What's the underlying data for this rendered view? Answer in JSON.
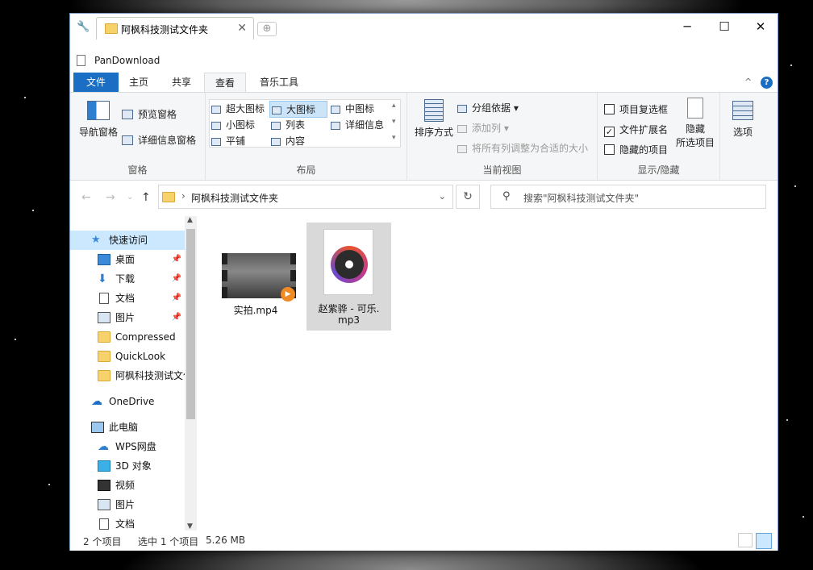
{
  "window": {
    "tab_title": "阿枫科技测试文件夹",
    "address_title": "PanDownload"
  },
  "ribbon_tabs": [
    "文件",
    "主页",
    "共享",
    "查看",
    "音乐工具"
  ],
  "ribbon": {
    "panes": {
      "nav_pane": "导航窗格",
      "preview_pane": "预览窗格",
      "details_pane": "详细信息窗格",
      "group": "窗格"
    },
    "layout": {
      "items": [
        "超大图标",
        "大图标",
        "中图标",
        "小图标",
        "列表",
        "详细信息",
        "平铺",
        "内容"
      ],
      "selected": "大图标",
      "group": "布局"
    },
    "current_view": {
      "sort": "排序方式",
      "group_by": "分组依据",
      "add_columns": "添加列",
      "fit_columns": "将所有列调整为合适的大小",
      "group": "当前视图"
    },
    "show_hide": {
      "item_checkboxes": "项目复选框",
      "file_extensions": "文件扩展名",
      "hidden_items": "隐藏的项目",
      "hide_selected_1": "隐藏",
      "hide_selected_2": "所选项目",
      "group": "显示/隐藏"
    },
    "options": "选项"
  },
  "address": {
    "crumb": "阿枫科技测试文件夹",
    "search_placeholder": "搜索\"阿枫科技测试文件夹\""
  },
  "nav_pane": {
    "items": [
      {
        "label": "快速访问",
        "icon": "star-icon"
      },
      {
        "label": "桌面",
        "icon": "desktop-icon"
      },
      {
        "label": "下载",
        "icon": "download-icon"
      },
      {
        "label": "文档",
        "icon": "document-icon"
      },
      {
        "label": "图片",
        "icon": "picture-icon"
      },
      {
        "label": "Compressed",
        "icon": "folder-icon"
      },
      {
        "label": "QuickLook",
        "icon": "folder-icon"
      },
      {
        "label": "阿枫科技测试文件夹",
        "icon": "folder-icon"
      },
      {
        "label": "OneDrive",
        "icon": "cloud-icon"
      },
      {
        "label": "此电脑",
        "icon": "computer-icon"
      },
      {
        "label": "WPS网盘",
        "icon": "cloud-icon"
      },
      {
        "label": "3D 对象",
        "icon": "cube-icon"
      },
      {
        "label": "视频",
        "icon": "video-icon"
      },
      {
        "label": "图片",
        "icon": "picture-icon"
      },
      {
        "label": "文档",
        "icon": "document-icon"
      }
    ]
  },
  "files": [
    {
      "name": "实拍.mp4"
    },
    {
      "name": "赵紫骅 - 可乐.mp3",
      "line1": "赵紫骅 - 可乐.",
      "line2": "mp3"
    }
  ],
  "status": {
    "count": "2 个项目",
    "selected": "选中 1 个项目",
    "size": "5.26 MB"
  },
  "colors": {
    "accent": "#1a6ec4",
    "selection": "#cce8ff"
  }
}
